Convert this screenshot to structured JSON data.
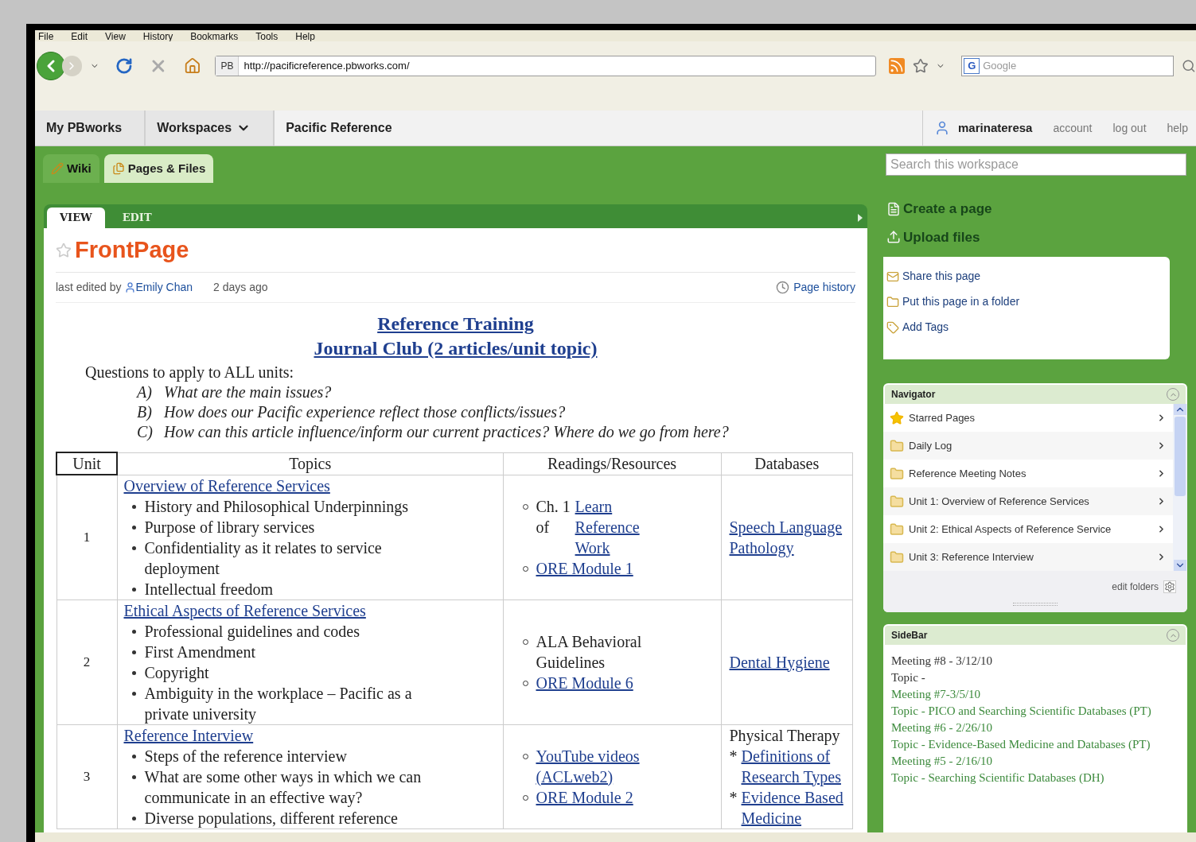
{
  "browser": {
    "menu": [
      "File",
      "Edit",
      "View",
      "History",
      "Bookmarks",
      "Tools",
      "Help"
    ],
    "favicon_label": "PB",
    "url": "http://pacificreference.pbworks.com/",
    "search_placeholder": "Google",
    "engine_label": "G"
  },
  "header": {
    "nav": [
      {
        "label": "My PBworks",
        "dropdown": false
      },
      {
        "label": "Workspaces",
        "dropdown": true
      },
      {
        "label": "Pacific Reference",
        "dropdown": false
      }
    ],
    "user": "marinateresa",
    "links": [
      "account",
      "log out",
      "help"
    ]
  },
  "tabs": [
    {
      "label": "Wiki",
      "kind": "wiki",
      "selected": false
    },
    {
      "label": "Pages & Files",
      "kind": "files",
      "selected": true
    }
  ],
  "search": {
    "placeholder": "Search this workspace"
  },
  "page_tabs": [
    {
      "label": "VIEW",
      "selected": true
    },
    {
      "label": "EDIT",
      "selected": false
    }
  ],
  "page": {
    "title": "FrontPage",
    "starred": false,
    "edited_prefix": "last edited by",
    "editor": "Emily Chan",
    "edited_when": "2 days ago",
    "history": "Page history",
    "headings": [
      "Reference Training",
      "Journal Club (2 articles/unit topic)"
    ],
    "intro": "Questions to apply to ALL units:",
    "questions": [
      {
        "label": "A)",
        "text": "What are the main issues?"
      },
      {
        "label": "B)",
        "text": "How does our Pacific experience reflect those conflicts/issues?"
      },
      {
        "label": "C)",
        "text": "How can this article influence/inform our current practices? Where do we go from here?"
      }
    ],
    "table": {
      "columns": [
        "Unit",
        "Topics",
        "Readings/Resources",
        "Databases"
      ],
      "rows": [
        {
          "unit": "1",
          "topic": "Overview of Reference Services",
          "bullets": [
            "History and Philosophical Underpinnings",
            "Purpose of library services",
            "Confidentiality as it relates to service deployment",
            "Intellectual freedom"
          ],
          "readings": [
            [
              {
                "text": "Ch. 1 of",
                "link": false
              },
              {
                "text": "Learn Reference Work",
                "link": true
              }
            ],
            [
              {
                "text": "ORE Module 1",
                "link": true
              }
            ]
          ],
          "databases": [
            [
              {
                "text": "Speech Language Pathology",
                "link": true
              }
            ]
          ]
        },
        {
          "unit": "2",
          "topic": "Ethical Aspects of Reference Services",
          "bullets": [
            "Professional guidelines and codes",
            "First Amendment",
            "Copyright",
            "Ambiguity in the workplace – Pacific as a private university"
          ],
          "readings": [
            [
              {
                "text": "ALA Behavioral Guidelines",
                "link": false
              }
            ],
            [
              {
                "text": "ORE Module 6",
                "link": true
              }
            ]
          ],
          "databases": [
            [
              {
                "text": "Dental Hygiene",
                "link": true
              }
            ]
          ]
        },
        {
          "unit": "3",
          "topic": "Reference Interview",
          "bullets": [
            "Steps of the reference interview",
            "What are some other ways in which we can communicate in an effective way?",
            "Diverse populations, different reference"
          ],
          "readings": [
            [
              {
                "text": "YouTube videos (ACLweb2)",
                "link": true
              }
            ],
            [
              {
                "text": "ORE Module 2",
                "link": true
              }
            ]
          ],
          "databases": [
            [
              {
                "text": "Physical Therapy",
                "link": false
              }
            ],
            [
              {
                "text": "*",
                "link": false
              },
              {
                "text": "Definitions of Research Types",
                "link": true
              }
            ],
            [
              {
                "text": "*",
                "link": false
              },
              {
                "text": "Evidence Based Medicine",
                "link": true
              }
            ]
          ]
        }
      ]
    }
  },
  "actions": [
    {
      "label": "Create a page",
      "kind": "create"
    },
    {
      "label": "Upload files",
      "kind": "upload"
    }
  ],
  "page_actions": [
    {
      "label": "Share this page",
      "kind": "share"
    },
    {
      "label": "Put this page in a folder",
      "kind": "folder"
    },
    {
      "label": "Add Tags",
      "kind": "tag"
    }
  ],
  "navigator": {
    "title": "Navigator",
    "items": [
      {
        "label": "Starred Pages",
        "kind": "starred"
      },
      {
        "label": "Daily Log",
        "kind": "folder"
      },
      {
        "label": "Reference Meeting Notes",
        "kind": "folder"
      },
      {
        "label": "Unit 1: Overview of Reference Services",
        "kind": "folder"
      },
      {
        "label": "Unit 2: Ethical Aspects of Reference Service",
        "kind": "folder"
      },
      {
        "label": "Unit 3: Reference Interview",
        "kind": "folder"
      }
    ],
    "edit_label": "edit folders"
  },
  "sidebar": {
    "title": "SideBar",
    "lines": [
      {
        "text": "Meeting #8 - 3/12/10",
        "link": false
      },
      {
        "text": "Topic -",
        "link": false
      },
      {
        "text": "Meeting #7-3/5/10",
        "link": true
      },
      {
        "text": "Topic - PICO and Searching Scientific Databases (PT)",
        "link": true
      },
      {
        "text": "Meeting #6 - 2/26/10",
        "link": true
      },
      {
        "text": "Topic - Evidence-Based Medicine and Databases (PT)",
        "link": true
      },
      {
        "text": "Meeting #5 - 2/16/10",
        "link": true
      },
      {
        "text": "Topic - Searching Scientific Databases (DH)",
        "link": true
      }
    ]
  }
}
